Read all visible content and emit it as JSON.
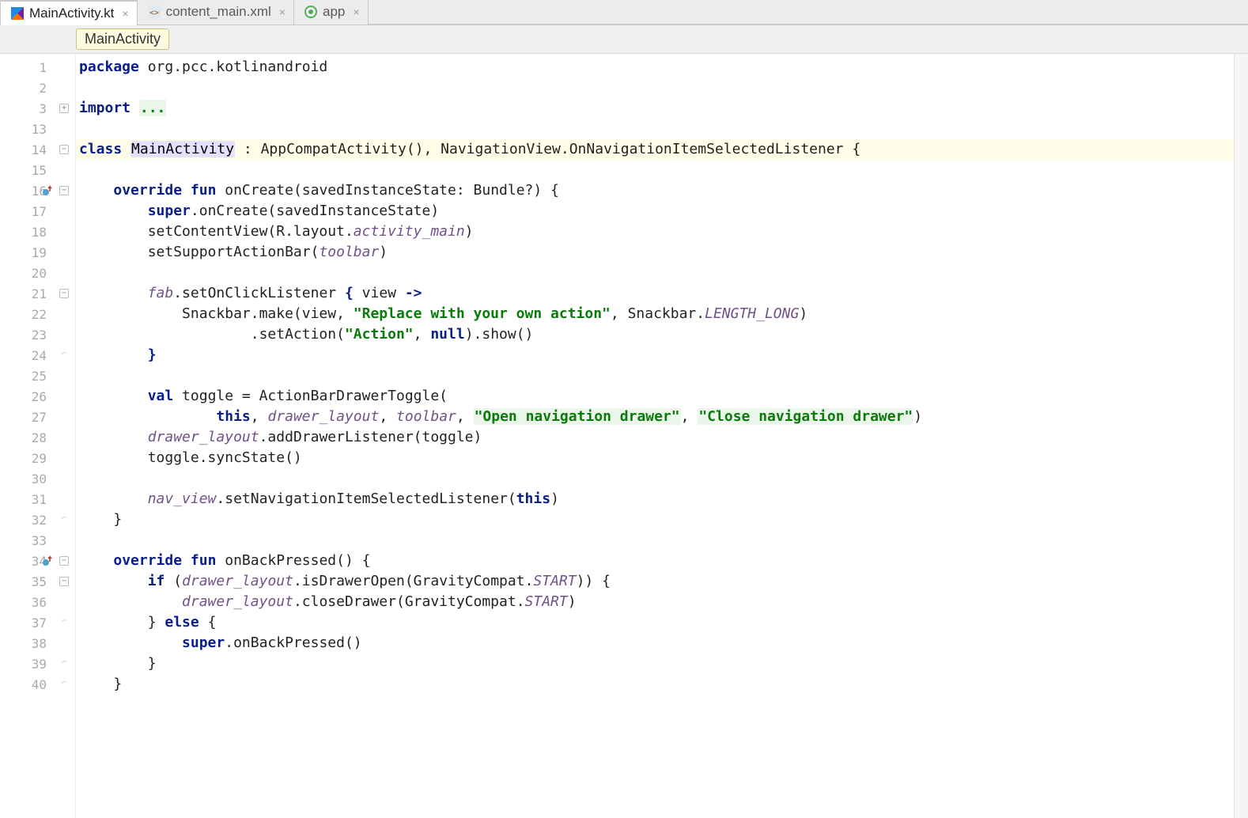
{
  "tabs": [
    {
      "label": "MainActivity.kt",
      "active": true,
      "icon": "kotlin"
    },
    {
      "label": "content_main.xml",
      "active": false,
      "icon": "xml"
    },
    {
      "label": "app",
      "active": false,
      "icon": "gradle"
    }
  ],
  "breadcrumb": "MainActivity",
  "lines": [
    {
      "n": "1",
      "fold": "",
      "marker": "",
      "tokens": [
        [
          "kw",
          "package"
        ],
        [
          "plain",
          " org.pcc.kotlinandroid"
        ]
      ]
    },
    {
      "n": "2",
      "fold": "",
      "marker": "",
      "tokens": []
    },
    {
      "n": "3",
      "fold": "plus",
      "marker": "",
      "tokens": [
        [
          "kw",
          "import"
        ],
        [
          "plain",
          " "
        ],
        [
          "hl-inject",
          "..."
        ]
      ]
    },
    {
      "n": "13",
      "fold": "",
      "marker": "",
      "tokens": []
    },
    {
      "n": "14",
      "fold": "minus",
      "marker": "",
      "hl": true,
      "tokens": [
        [
          "kw",
          "class"
        ],
        [
          "plain",
          " "
        ],
        [
          "hl-usage",
          "MainActivity"
        ],
        [
          "plain",
          " : AppCompatActivity(), NavigationView.OnNavigationItemSelectedListener {"
        ]
      ]
    },
    {
      "n": "15",
      "fold": "",
      "marker": "",
      "tokens": []
    },
    {
      "n": "16",
      "fold": "minus",
      "marker": "override",
      "tokens": [
        [
          "plain",
          "    "
        ],
        [
          "kw",
          "override fun"
        ],
        [
          "plain",
          " onCreate(savedInstanceState: Bundle?) {"
        ]
      ]
    },
    {
      "n": "17",
      "fold": "",
      "marker": "",
      "tokens": [
        [
          "plain",
          "        "
        ],
        [
          "kw2",
          "super"
        ],
        [
          "plain",
          ".onCreate(savedInstanceState)"
        ]
      ]
    },
    {
      "n": "18",
      "fold": "",
      "marker": "",
      "tokens": [
        [
          "plain",
          "        setContentView(R.layout."
        ],
        [
          "italic-purple",
          "activity_main"
        ],
        [
          "plain",
          ")"
        ]
      ]
    },
    {
      "n": "19",
      "fold": "",
      "marker": "",
      "tokens": [
        [
          "plain",
          "        setSupportActionBar("
        ],
        [
          "italic-purple",
          "toolbar"
        ],
        [
          "plain",
          ")"
        ]
      ]
    },
    {
      "n": "20",
      "fold": "",
      "marker": "",
      "tokens": []
    },
    {
      "n": "21",
      "fold": "minus",
      "marker": "",
      "tokens": [
        [
          "plain",
          "        "
        ],
        [
          "italic-purple",
          "fab"
        ],
        [
          "plain",
          ".setOnClickListener "
        ],
        [
          "kw",
          "{"
        ],
        [
          "plain",
          " view "
        ],
        [
          "kw",
          "->"
        ]
      ]
    },
    {
      "n": "22",
      "fold": "",
      "marker": "",
      "tokens": [
        [
          "plain",
          "            Snackbar.make(view, "
        ],
        [
          "str",
          "\"Replace with your own action\""
        ],
        [
          "plain",
          ", Snackbar."
        ],
        [
          "static-purple",
          "LENGTH_LONG"
        ],
        [
          "plain",
          ")"
        ]
      ]
    },
    {
      "n": "23",
      "fold": "",
      "marker": "",
      "tokens": [
        [
          "plain",
          "                    .setAction("
        ],
        [
          "str",
          "\"Action\""
        ],
        [
          "plain",
          ", "
        ],
        [
          "kw2",
          "null"
        ],
        [
          "plain",
          ").show()"
        ]
      ]
    },
    {
      "n": "24",
      "fold": "end",
      "marker": "",
      "tokens": [
        [
          "plain",
          "        "
        ],
        [
          "kw",
          "}"
        ]
      ]
    },
    {
      "n": "25",
      "fold": "",
      "marker": "",
      "tokens": []
    },
    {
      "n": "26",
      "fold": "",
      "marker": "",
      "tokens": [
        [
          "plain",
          "        "
        ],
        [
          "kw",
          "val"
        ],
        [
          "plain",
          " toggle = ActionBarDrawerToggle("
        ]
      ]
    },
    {
      "n": "27",
      "fold": "",
      "marker": "",
      "tokens": [
        [
          "plain",
          "                "
        ],
        [
          "kw2",
          "this"
        ],
        [
          "plain",
          ", "
        ],
        [
          "italic-purple",
          "drawer_layout"
        ],
        [
          "plain",
          ", "
        ],
        [
          "italic-purple",
          "toolbar"
        ],
        [
          "plain",
          ", "
        ],
        [
          "hl-inject",
          "\"Open navigation drawer\""
        ],
        [
          "plain",
          ", "
        ],
        [
          "hl-inject",
          "\"Close navigation drawer\""
        ],
        [
          "plain",
          ")"
        ]
      ]
    },
    {
      "n": "28",
      "fold": "",
      "marker": "",
      "tokens": [
        [
          "plain",
          "        "
        ],
        [
          "italic-purple",
          "drawer_layout"
        ],
        [
          "plain",
          ".addDrawerListener(toggle)"
        ]
      ]
    },
    {
      "n": "29",
      "fold": "",
      "marker": "",
      "tokens": [
        [
          "plain",
          "        toggle.syncState()"
        ]
      ]
    },
    {
      "n": "30",
      "fold": "",
      "marker": "",
      "tokens": []
    },
    {
      "n": "31",
      "fold": "",
      "marker": "",
      "tokens": [
        [
          "plain",
          "        "
        ],
        [
          "italic-purple",
          "nav_view"
        ],
        [
          "plain",
          ".setNavigationItemSelectedListener("
        ],
        [
          "kw2",
          "this"
        ],
        [
          "plain",
          ")"
        ]
      ]
    },
    {
      "n": "32",
      "fold": "end",
      "marker": "",
      "tokens": [
        [
          "plain",
          "    }"
        ]
      ]
    },
    {
      "n": "33",
      "fold": "",
      "marker": "",
      "tokens": []
    },
    {
      "n": "34",
      "fold": "minus",
      "marker": "override",
      "tokens": [
        [
          "plain",
          "    "
        ],
        [
          "kw",
          "override fun"
        ],
        [
          "plain",
          " onBackPressed() {"
        ]
      ]
    },
    {
      "n": "35",
      "fold": "minus",
      "marker": "",
      "tokens": [
        [
          "plain",
          "        "
        ],
        [
          "kw",
          "if"
        ],
        [
          "plain",
          " ("
        ],
        [
          "italic-purple",
          "drawer_layout"
        ],
        [
          "plain",
          ".isDrawerOpen(GravityCompat."
        ],
        [
          "static-purple",
          "START"
        ],
        [
          "plain",
          ")) {"
        ]
      ]
    },
    {
      "n": "36",
      "fold": "",
      "marker": "",
      "tokens": [
        [
          "plain",
          "            "
        ],
        [
          "italic-purple",
          "drawer_layout"
        ],
        [
          "plain",
          ".closeDrawer(GravityCompat."
        ],
        [
          "static-purple",
          "START"
        ],
        [
          "plain",
          ")"
        ]
      ]
    },
    {
      "n": "37",
      "fold": "end",
      "marker": "",
      "tokens": [
        [
          "plain",
          "        } "
        ],
        [
          "kw",
          "else"
        ],
        [
          "plain",
          " {"
        ]
      ]
    },
    {
      "n": "38",
      "fold": "",
      "marker": "",
      "tokens": [
        [
          "plain",
          "            "
        ],
        [
          "kw2",
          "super"
        ],
        [
          "plain",
          ".onBackPressed()"
        ]
      ]
    },
    {
      "n": "39",
      "fold": "end",
      "marker": "",
      "tokens": [
        [
          "plain",
          "        }"
        ]
      ]
    },
    {
      "n": "40",
      "fold": "end",
      "marker": "",
      "tokens": [
        [
          "plain",
          "    }"
        ]
      ]
    }
  ]
}
